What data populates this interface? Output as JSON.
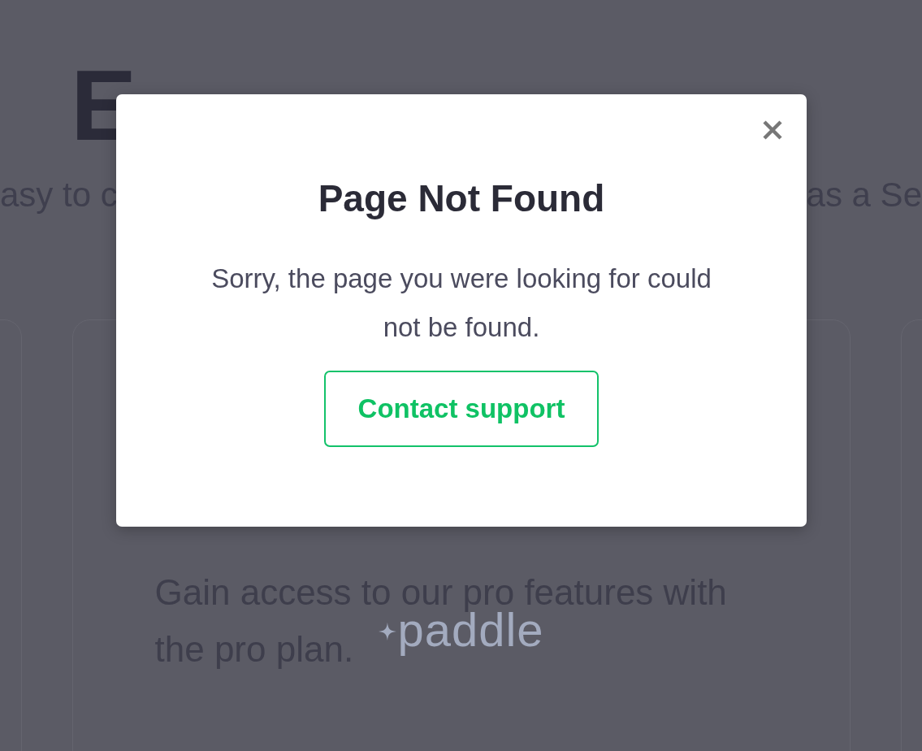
{
  "page": {
    "heading": "E",
    "subtitle_fragments": [
      "asy to c",
      "as a Se"
    ]
  },
  "card": {
    "description_lines": [
      "Gain access to our pro features with",
      "the pro plan."
    ]
  },
  "dialog": {
    "title": "Page Not Found",
    "message": "Sorry, the page you were looking for could not be found.",
    "button": "Contact support",
    "dismissible": true
  },
  "overlay_logo": {
    "text": "paddle"
  }
}
